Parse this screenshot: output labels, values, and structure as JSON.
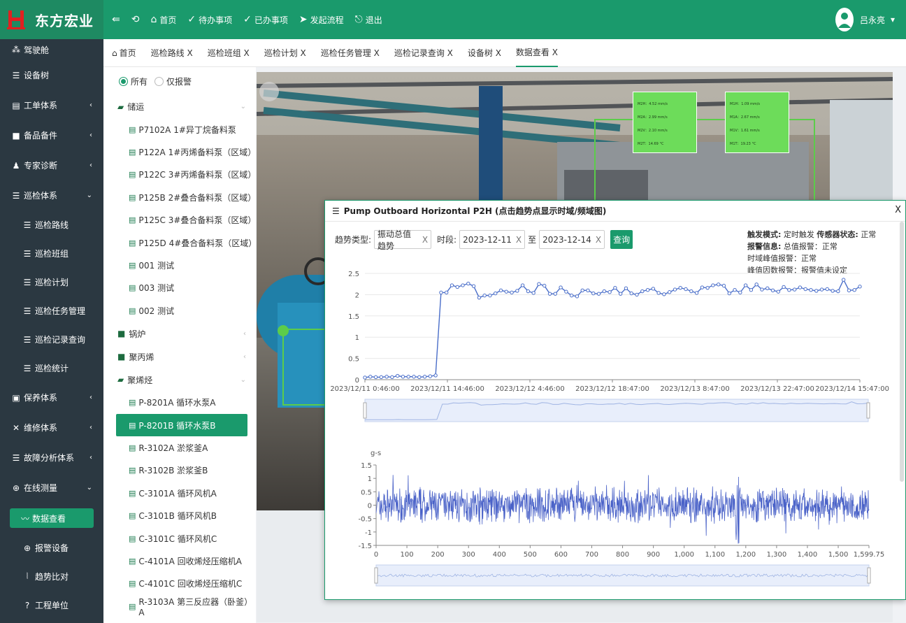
{
  "brand": {
    "name": "东方宏业"
  },
  "topnav": {
    "items": [
      {
        "label": ""
      },
      {
        "label": ""
      },
      {
        "label": "首页"
      },
      {
        "label": "待办事项"
      },
      {
        "label": "已办事项"
      },
      {
        "label": "发起流程"
      },
      {
        "label": "退出"
      }
    ],
    "user": "吕永亮"
  },
  "sidebar": {
    "items": [
      {
        "label": "驾驶舱"
      },
      {
        "label": "设备树"
      },
      {
        "label": "工单体系"
      },
      {
        "label": "备品备件"
      },
      {
        "label": "专家诊断"
      },
      {
        "label": "巡检体系"
      },
      {
        "label": "巡检路线"
      },
      {
        "label": "巡检班组"
      },
      {
        "label": "巡检计划"
      },
      {
        "label": "巡检任务管理"
      },
      {
        "label": "巡检记录查询"
      },
      {
        "label": "巡检统计"
      },
      {
        "label": "保养体系"
      },
      {
        "label": "维修体系"
      },
      {
        "label": "故障分析体系"
      },
      {
        "label": "在线测量"
      },
      {
        "label": "数据查看"
      },
      {
        "label": "报警设备"
      },
      {
        "label": "趋势比对"
      },
      {
        "label": "工程单位"
      }
    ]
  },
  "tabs": [
    {
      "label": "首页"
    },
    {
      "label": "巡检路线 X"
    },
    {
      "label": "巡检班组 X"
    },
    {
      "label": "巡检计划 X"
    },
    {
      "label": "巡检任务管理 X"
    },
    {
      "label": "巡检记录查询 X"
    },
    {
      "label": "设备树 X"
    },
    {
      "label": "数据查看 X"
    }
  ],
  "tree": {
    "filter_all": "所有",
    "filter_alarm": "仅报警",
    "nodes": [
      {
        "label": "储运"
      },
      {
        "label": "P7102A 1#异丁烷备料泵"
      },
      {
        "label": "P122A 1#丙烯备料泵（区域）"
      },
      {
        "label": "P122C 3#丙烯备料泵（区域）"
      },
      {
        "label": "P125B 2#叠合备料泵（区域）"
      },
      {
        "label": "P125C 3#叠合备料泵（区域）"
      },
      {
        "label": "P125D 4#叠合备料泵（区域）"
      },
      {
        "label": "001 测试"
      },
      {
        "label": "003 测试"
      },
      {
        "label": "002 测试"
      },
      {
        "label": "锅炉"
      },
      {
        "label": "聚丙烯"
      },
      {
        "label": "聚烯烃"
      },
      {
        "label": "P-8201A 循环水泵A"
      },
      {
        "label": "P-8201B 循环水泵B"
      },
      {
        "label": "R-3102A 淤浆釜A"
      },
      {
        "label": "R-3102B 淤浆釜B"
      },
      {
        "label": "C-3101A 循环风机A"
      },
      {
        "label": "C-3101B 循环风机B"
      },
      {
        "label": "C-3101C 循环风机C"
      },
      {
        "label": "C-4101A 回收烯烃压缩机A"
      },
      {
        "label": "C-4101C 回收烯烃压缩机C"
      },
      {
        "label": "R-3103A 第三反应器（卧釜）A"
      }
    ]
  },
  "sensors": [
    {
      "lines": [
        "M2H：4.52 mm/s",
        "M2A：2.99 mm/s",
        "M2V：2.10 mm/s",
        "M2T：14.69 °C"
      ]
    },
    {
      "lines": [
        "M1H：1.09 mm/s",
        "M1A：2.67 mm/s",
        "M1V：1.61 mm/s",
        "M1T：19.23 °C"
      ]
    }
  ],
  "modal": {
    "title": "Pump Outboard Horizontal P2H (点击趋势点显示时域/频域图)",
    "close": "X",
    "trend_type_label": "趋势类型:",
    "trend_type_value": "振动总值趋势",
    "period_label": "时段:",
    "date_from": "2023-12-11",
    "to_label": "至",
    "date_to": "2023-12-14",
    "query_label": "查询",
    "clear": "X",
    "info": [
      {
        "k": "触发模式:",
        "v": "定时触发",
        "k2": "传感器状态:",
        "v2": "正常"
      },
      {
        "k": "报警信息:",
        "v": "总值报警：正常"
      },
      {
        "k": "",
        "v": "时域峰值报警：正常"
      },
      {
        "k": "",
        "v": "峰值因数报警：报警值未设定"
      }
    ]
  },
  "chart_data": [
    {
      "type": "line",
      "title": "",
      "x_ticks": [
        "2023/12/11 0:46:00",
        "2023/12/11 14:46:00",
        "2023/12/12 4:46:00",
        "2023/12/12 18:47:00",
        "2023/12/13 8:47:00",
        "2023/12/13 22:47:00",
        "2023/12/14 15:47:00"
      ],
      "ylim": [
        0,
        2.5
      ],
      "y_ticks": [
        0,
        0.5,
        1,
        1.5,
        2,
        2.5
      ],
      "values": [
        0.05,
        0.07,
        0.06,
        0.06,
        0.07,
        0.06,
        0.09,
        0.07,
        0.07,
        0.07,
        0.06,
        0.07,
        0.08,
        0.1,
        2.05,
        2.05,
        2.22,
        2.18,
        2.22,
        2.26,
        2.2,
        1.93,
        1.98,
        1.98,
        2.03,
        2.1,
        2.07,
        2.05,
        2.09,
        2.22,
        2.08,
        2.04,
        2.25,
        2.21,
        2.02,
        2.02,
        2.17,
        2.07,
        1.98,
        1.96,
        2.1,
        2.1,
        2.03,
        2.02,
        2.08,
        2.06,
        2.16,
        2.02,
        2.15,
        2.03,
        2.0,
        2.08,
        2.11,
        2.14,
        2.04,
        2.01,
        2.06,
        2.12,
        2.16,
        2.13,
        2.08,
        2.04,
        2.17,
        2.16,
        2.22,
        2.24,
        2.21,
        2.03,
        2.11,
        2.05,
        2.22,
        2.11,
        2.24,
        2.12,
        2.15,
        2.1,
        2.07,
        2.18,
        2.11,
        2.12,
        2.17,
        2.13,
        2.11,
        2.09,
        2.12,
        2.13,
        2.09,
        2.08,
        2.35,
        2.1,
        2.11,
        2.19
      ]
    },
    {
      "type": "line",
      "title": "",
      "ylabel": "g-s",
      "xlim": [
        0,
        1599.75
      ],
      "ylim": [
        -1.5,
        1.5
      ],
      "x_ticks": [
        "0",
        "100",
        "200",
        "300",
        "400",
        "500",
        "600",
        "700",
        "800",
        "900",
        "1,000",
        "1,100",
        "1,200",
        "1,300",
        "1,400",
        "1,500",
        "1,599.75"
      ],
      "y_ticks": [
        "1.5",
        "1",
        "0.5",
        "0",
        "-0.5",
        "-1",
        "-1.5"
      ],
      "signal": "vibration waveform, amplitude about ±0.6 g-s with peaks near ±1.0"
    }
  ]
}
